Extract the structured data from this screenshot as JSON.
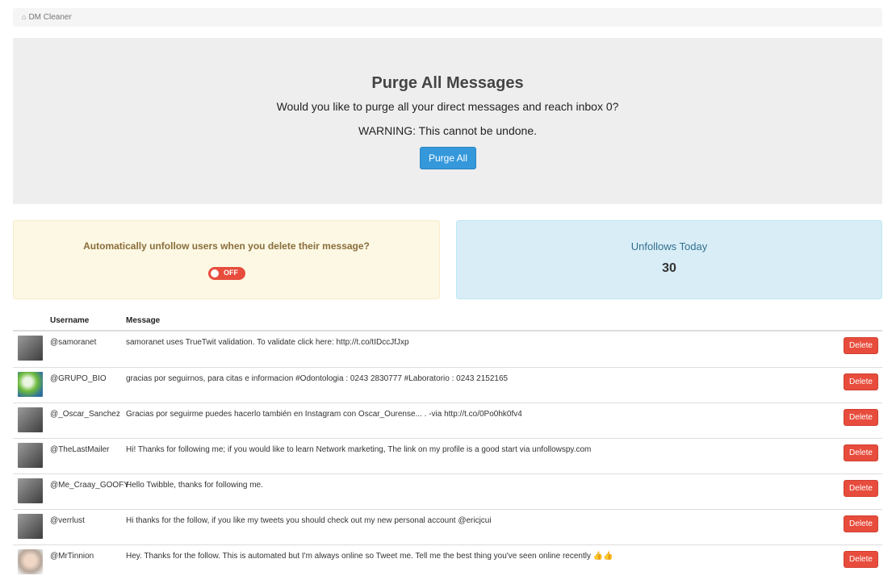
{
  "breadcrumb": {
    "icon": "home-icon",
    "label": "DM Cleaner"
  },
  "purge": {
    "title": "Purge All Messages",
    "lead": "Would you like to purge all your direct messages and reach inbox 0?",
    "warning": "WARNING: This cannot be undone.",
    "button_label": "Purge All"
  },
  "auto_unfollow": {
    "question": "Automatically unfollow users when you delete their message?",
    "toggle_label": "OFF",
    "toggle_state": "off"
  },
  "unfollows": {
    "title": "Unfollows Today",
    "count": "30"
  },
  "table": {
    "headers": {
      "username": "Username",
      "message": "Message"
    },
    "delete_label": "Delete",
    "rows": [
      {
        "username": "@samoranet",
        "message": "samoranet uses TrueTwit validation. To validate click here: http://t.co/tIDccJfJxp"
      },
      {
        "username": "@GRUPO_BIO",
        "message": "gracias por seguirnos, para citas e informacion #Odontologia : 0243 2830777 #Laboratorio : 0243 2152165"
      },
      {
        "username": "@_Oscar_Sanchez",
        "message": "Gracias por seguirme puedes hacerlo también en Instagram con Oscar_Ourense... . -via http://t.co/0Po0hk0fv4"
      },
      {
        "username": "@TheLastMailer",
        "message": "Hi! Thanks for following me; if you would like to learn Network marketing, The link on my profile is a good start via unfollowspy.com"
      },
      {
        "username": "@Me_Craay_GOOFY",
        "message": "Hello Twibble, thanks for following me."
      },
      {
        "username": "@verrlust",
        "message": "Hi thanks for the follow, if you like my tweets you should check out my new personal account @ericjcui"
      },
      {
        "username": "@MrTinnion",
        "message": "Hey. Thanks for the follow. This is automated but I'm always online so Tweet me. Tell me the best thing you've seen online recently 👍👍"
      }
    ]
  },
  "colors": {
    "primary": "#3498db",
    "danger": "#e74c3c",
    "warning_bg": "#fcf8e3",
    "info_bg": "#d9edf7"
  }
}
